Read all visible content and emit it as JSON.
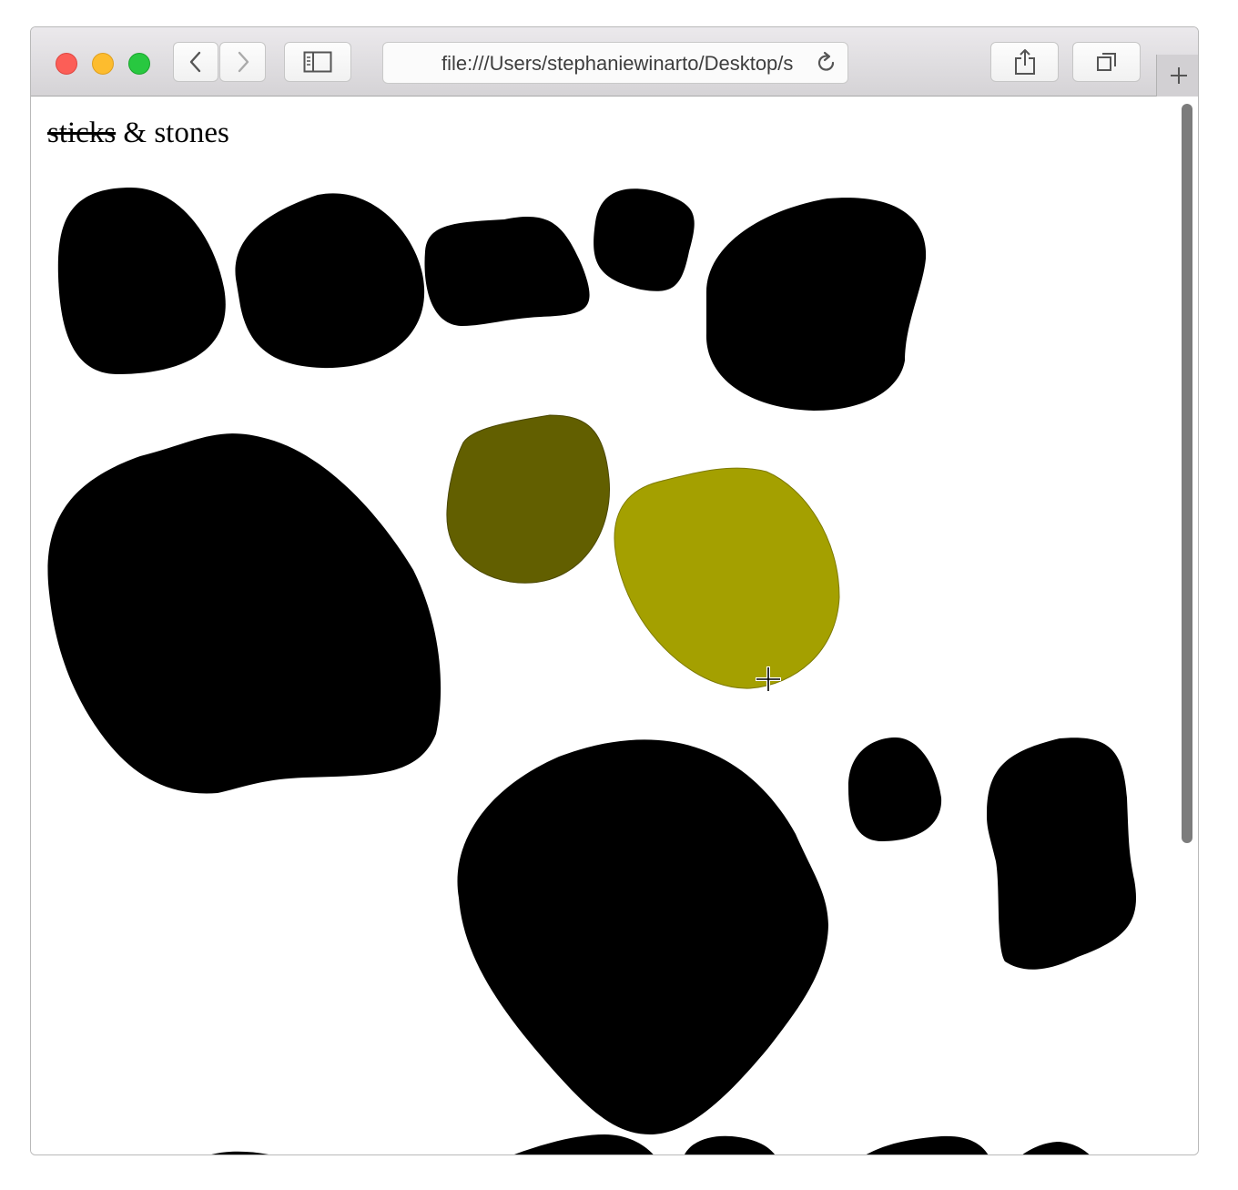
{
  "browser": {
    "url": "file:///Users/stephaniewinarto/Desktop/sticks-and-stones/index.html",
    "buttons": {
      "back": "chevron-left-icon",
      "forward": "chevron-right-icon",
      "sidebar": "sidebar-icon",
      "reload": "reload-icon",
      "share": "share-icon",
      "tabs": "tab-overview-icon",
      "new_tab": "plus-icon"
    }
  },
  "page": {
    "title_struck": "sticks",
    "title_rest": " & stones"
  },
  "stones": {
    "default_color": "#000000",
    "hovered_color": "#a4a000",
    "previous_hover_color": "#625f00",
    "count_visible": 16
  }
}
